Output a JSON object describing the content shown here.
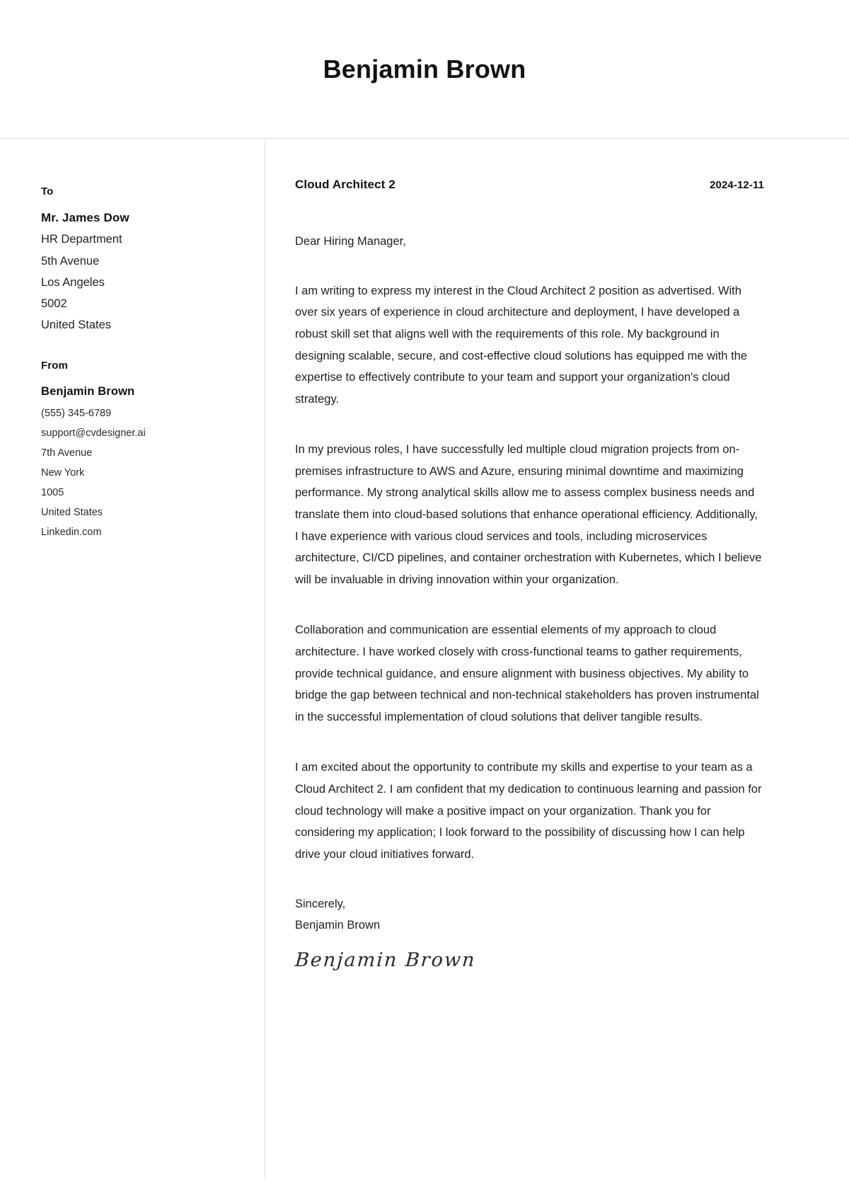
{
  "header": {
    "candidate_name": "Benjamin Brown"
  },
  "sidebar": {
    "to": {
      "heading": "To",
      "name": "Mr. James Dow",
      "lines": [
        "HR Department",
        "5th Avenue",
        "Los Angeles",
        "5002",
        "United States"
      ]
    },
    "from": {
      "heading": "From",
      "name": "Benjamin Brown",
      "lines": [
        "(555) 345-6789",
        "support@cvdesigner.ai",
        "7th Avenue",
        "New York",
        "1005",
        "United States",
        "Linkedin.com"
      ]
    }
  },
  "main": {
    "job_title": "Cloud Architect 2",
    "date": "2024-12-11",
    "salutation": "Dear Hiring Manager,",
    "paragraphs": [
      "I am writing to express my interest in the Cloud Architect 2 position as advertised. With over six years of experience in cloud architecture and deployment, I have developed a robust skill set that aligns well with the requirements of this role. My background in designing scalable, secure, and cost-effective cloud solutions has equipped me with the expertise to effectively contribute to your team and support your organization's cloud strategy.",
      "In my previous roles, I have successfully led multiple cloud migration projects from on-premises infrastructure to AWS and Azure, ensuring minimal downtime and maximizing performance. My strong analytical skills allow me to assess complex business needs and translate them into cloud-based solutions that enhance operational efficiency. Additionally, I have experience with various cloud services and tools, including microservices architecture, CI/CD pipelines, and container orchestration with Kubernetes, which I believe will be invaluable in driving innovation within your organization.",
      "Collaboration and communication are essential elements of my approach to cloud architecture. I have worked closely with cross-functional teams to gather requirements, provide technical guidance, and ensure alignment with business objectives. My ability to bridge the gap between technical and non-technical stakeholders has proven instrumental in the successful implementation of cloud solutions that deliver tangible results.",
      "I am excited about the opportunity to contribute my skills and expertise to your team as a Cloud Architect 2. I am confident that my dedication to continuous learning and passion for cloud technology will make a positive impact on your organization. Thank you for considering my application; I look forward to the possibility of discussing how I can help drive your cloud initiatives forward."
    ],
    "closing_word": "Sincerely,",
    "closing_name": "Benjamin Brown",
    "signature": "Benjamin Brown"
  }
}
